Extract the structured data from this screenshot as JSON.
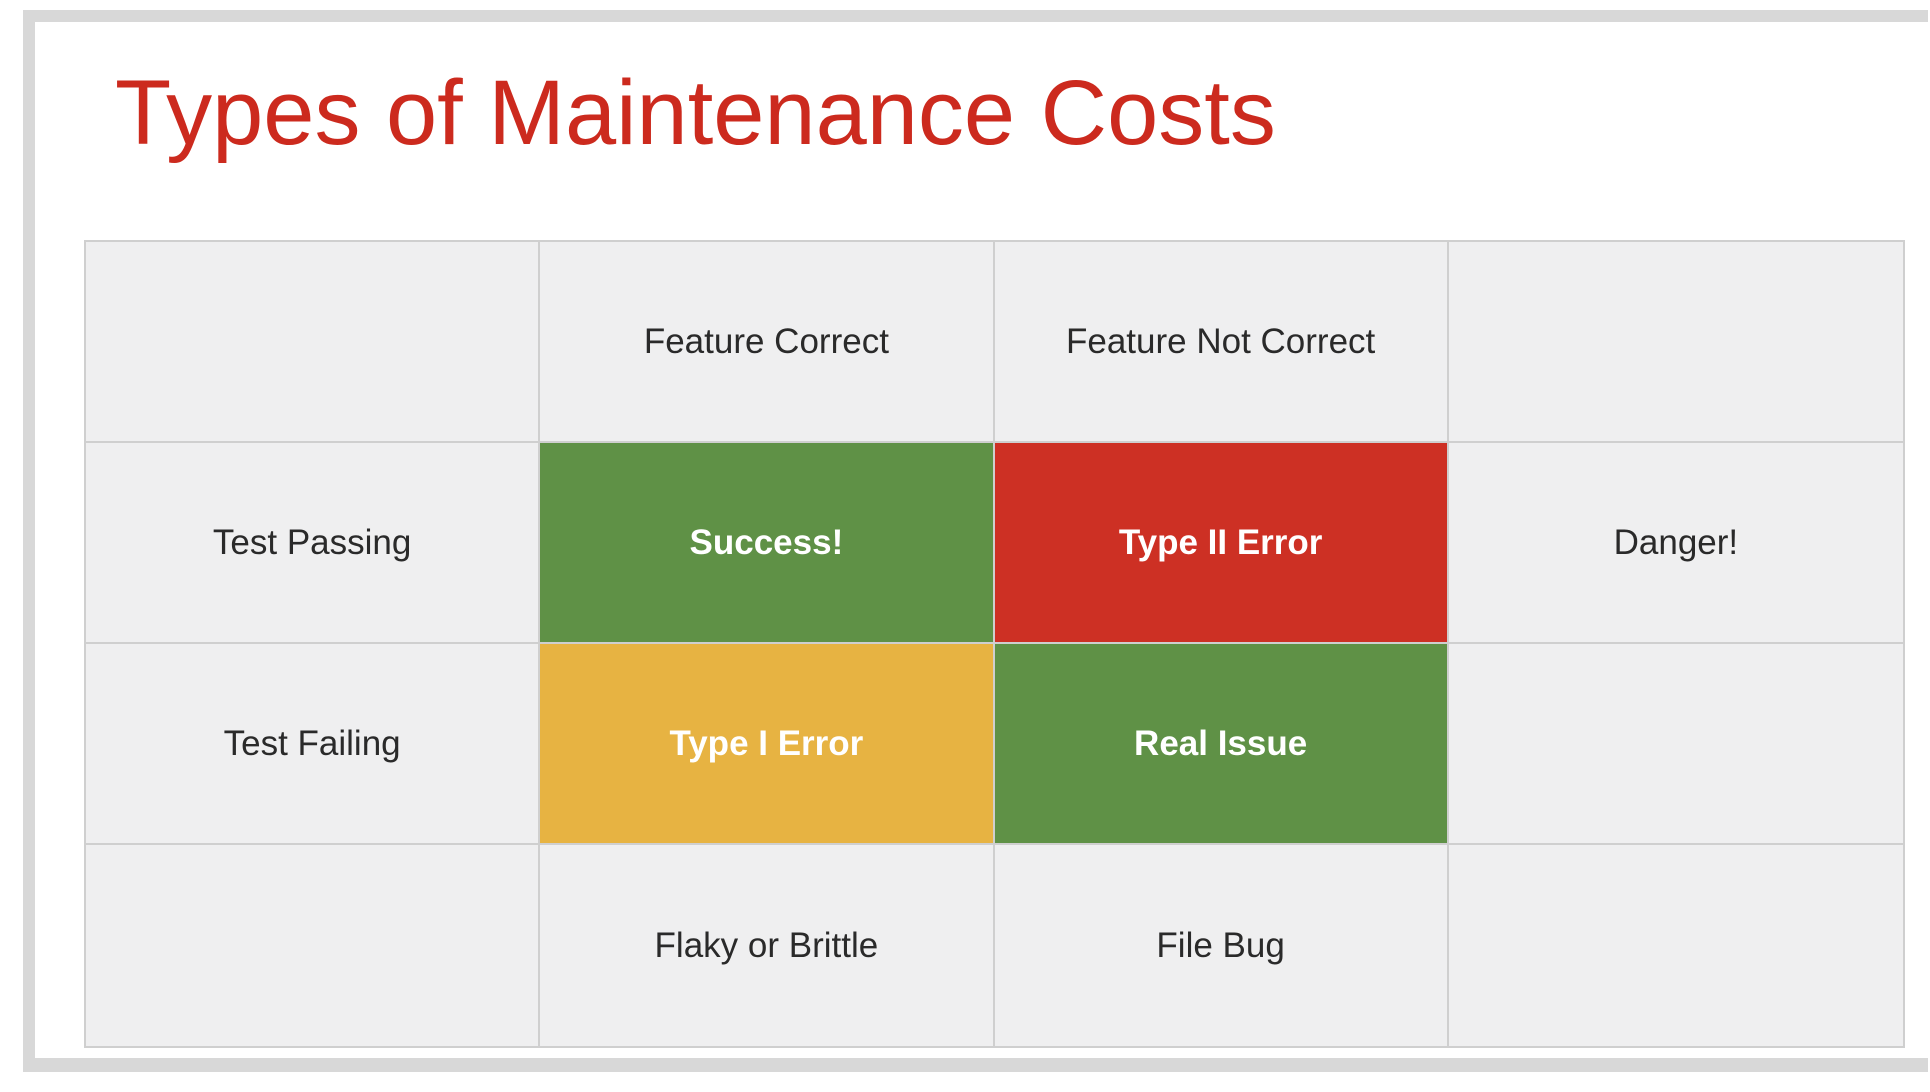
{
  "slide": {
    "title": "Types of Maintenance Costs"
  },
  "matrix": {
    "column_headers": [
      "",
      "Feature Correct",
      "Feature Not Correct",
      ""
    ],
    "rows": [
      {
        "label": "Test Passing",
        "cells": [
          {
            "text": "Success!",
            "color": "#5f9146"
          },
          {
            "text": "Type II Error",
            "color": "#cd3024"
          }
        ],
        "note": "Danger!"
      },
      {
        "label": "Test Failing",
        "cells": [
          {
            "text": "Type I Error",
            "color": "#e7b342"
          },
          {
            "text": "Real Issue",
            "color": "#5f9146"
          }
        ],
        "note": ""
      }
    ],
    "footer": [
      "",
      "Flaky or Brittle",
      "File Bug",
      ""
    ]
  },
  "colors": {
    "title": "#cc2a1e",
    "cell_background": "#efeff0",
    "grid_line": "#cfcfcf",
    "success": "#5f9146",
    "type_ii_error": "#cd3024",
    "type_i_error": "#e7b342",
    "real_issue": "#5f9146"
  }
}
